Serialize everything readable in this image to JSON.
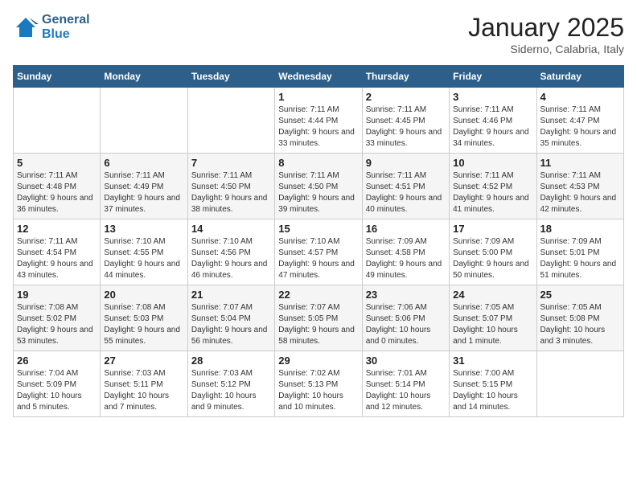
{
  "header": {
    "logo_line1": "General",
    "logo_line2": "Blue",
    "month": "January 2025",
    "location": "Siderno, Calabria, Italy"
  },
  "days_of_week": [
    "Sunday",
    "Monday",
    "Tuesday",
    "Wednesday",
    "Thursday",
    "Friday",
    "Saturday"
  ],
  "weeks": [
    [
      {
        "day": "",
        "info": ""
      },
      {
        "day": "",
        "info": ""
      },
      {
        "day": "",
        "info": ""
      },
      {
        "day": "1",
        "info": "Sunrise: 7:11 AM\nSunset: 4:44 PM\nDaylight: 9 hours and 33 minutes."
      },
      {
        "day": "2",
        "info": "Sunrise: 7:11 AM\nSunset: 4:45 PM\nDaylight: 9 hours and 33 minutes."
      },
      {
        "day": "3",
        "info": "Sunrise: 7:11 AM\nSunset: 4:46 PM\nDaylight: 9 hours and 34 minutes."
      },
      {
        "day": "4",
        "info": "Sunrise: 7:11 AM\nSunset: 4:47 PM\nDaylight: 9 hours and 35 minutes."
      }
    ],
    [
      {
        "day": "5",
        "info": "Sunrise: 7:11 AM\nSunset: 4:48 PM\nDaylight: 9 hours and 36 minutes."
      },
      {
        "day": "6",
        "info": "Sunrise: 7:11 AM\nSunset: 4:49 PM\nDaylight: 9 hours and 37 minutes."
      },
      {
        "day": "7",
        "info": "Sunrise: 7:11 AM\nSunset: 4:50 PM\nDaylight: 9 hours and 38 minutes."
      },
      {
        "day": "8",
        "info": "Sunrise: 7:11 AM\nSunset: 4:50 PM\nDaylight: 9 hours and 39 minutes."
      },
      {
        "day": "9",
        "info": "Sunrise: 7:11 AM\nSunset: 4:51 PM\nDaylight: 9 hours and 40 minutes."
      },
      {
        "day": "10",
        "info": "Sunrise: 7:11 AM\nSunset: 4:52 PM\nDaylight: 9 hours and 41 minutes."
      },
      {
        "day": "11",
        "info": "Sunrise: 7:11 AM\nSunset: 4:53 PM\nDaylight: 9 hours and 42 minutes."
      }
    ],
    [
      {
        "day": "12",
        "info": "Sunrise: 7:11 AM\nSunset: 4:54 PM\nDaylight: 9 hours and 43 minutes."
      },
      {
        "day": "13",
        "info": "Sunrise: 7:10 AM\nSunset: 4:55 PM\nDaylight: 9 hours and 44 minutes."
      },
      {
        "day": "14",
        "info": "Sunrise: 7:10 AM\nSunset: 4:56 PM\nDaylight: 9 hours and 46 minutes."
      },
      {
        "day": "15",
        "info": "Sunrise: 7:10 AM\nSunset: 4:57 PM\nDaylight: 9 hours and 47 minutes."
      },
      {
        "day": "16",
        "info": "Sunrise: 7:09 AM\nSunset: 4:58 PM\nDaylight: 9 hours and 49 minutes."
      },
      {
        "day": "17",
        "info": "Sunrise: 7:09 AM\nSunset: 5:00 PM\nDaylight: 9 hours and 50 minutes."
      },
      {
        "day": "18",
        "info": "Sunrise: 7:09 AM\nSunset: 5:01 PM\nDaylight: 9 hours and 51 minutes."
      }
    ],
    [
      {
        "day": "19",
        "info": "Sunrise: 7:08 AM\nSunset: 5:02 PM\nDaylight: 9 hours and 53 minutes."
      },
      {
        "day": "20",
        "info": "Sunrise: 7:08 AM\nSunset: 5:03 PM\nDaylight: 9 hours and 55 minutes."
      },
      {
        "day": "21",
        "info": "Sunrise: 7:07 AM\nSunset: 5:04 PM\nDaylight: 9 hours and 56 minutes."
      },
      {
        "day": "22",
        "info": "Sunrise: 7:07 AM\nSunset: 5:05 PM\nDaylight: 9 hours and 58 minutes."
      },
      {
        "day": "23",
        "info": "Sunrise: 7:06 AM\nSunset: 5:06 PM\nDaylight: 10 hours and 0 minutes."
      },
      {
        "day": "24",
        "info": "Sunrise: 7:05 AM\nSunset: 5:07 PM\nDaylight: 10 hours and 1 minute."
      },
      {
        "day": "25",
        "info": "Sunrise: 7:05 AM\nSunset: 5:08 PM\nDaylight: 10 hours and 3 minutes."
      }
    ],
    [
      {
        "day": "26",
        "info": "Sunrise: 7:04 AM\nSunset: 5:09 PM\nDaylight: 10 hours and 5 minutes."
      },
      {
        "day": "27",
        "info": "Sunrise: 7:03 AM\nSunset: 5:11 PM\nDaylight: 10 hours and 7 minutes."
      },
      {
        "day": "28",
        "info": "Sunrise: 7:03 AM\nSunset: 5:12 PM\nDaylight: 10 hours and 9 minutes."
      },
      {
        "day": "29",
        "info": "Sunrise: 7:02 AM\nSunset: 5:13 PM\nDaylight: 10 hours and 10 minutes."
      },
      {
        "day": "30",
        "info": "Sunrise: 7:01 AM\nSunset: 5:14 PM\nDaylight: 10 hours and 12 minutes."
      },
      {
        "day": "31",
        "info": "Sunrise: 7:00 AM\nSunset: 5:15 PM\nDaylight: 10 hours and 14 minutes."
      },
      {
        "day": "",
        "info": ""
      }
    ]
  ]
}
